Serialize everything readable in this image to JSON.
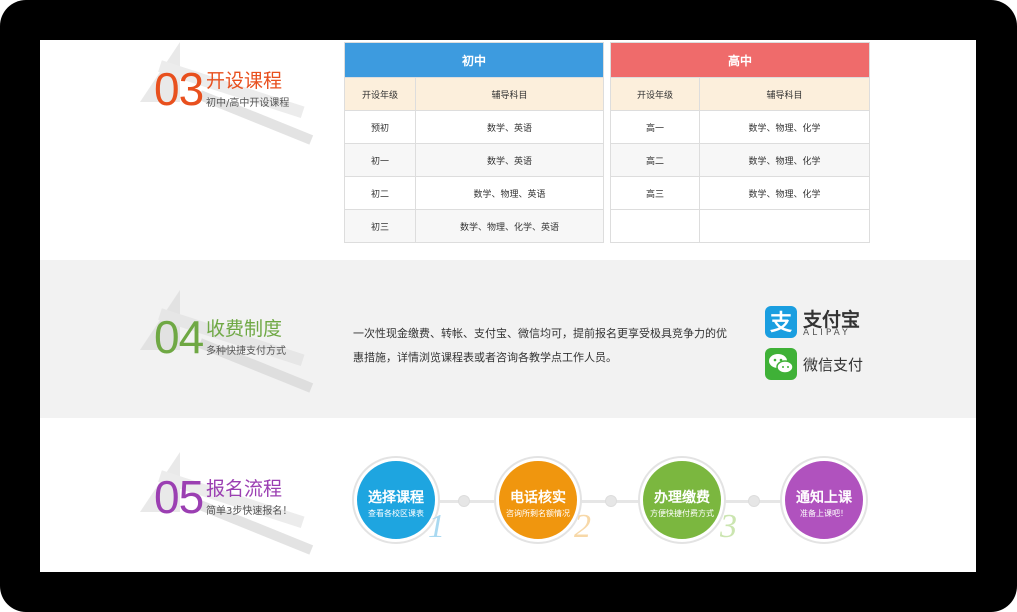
{
  "s03": {
    "num": "03",
    "title": "开设课程",
    "sub": "初中/高中开设课程"
  },
  "s04": {
    "num": "04",
    "title": "收费制度",
    "sub": "多种快捷支付方式"
  },
  "s05": {
    "num": "05",
    "title": "报名流程",
    "sub": "简单3步快速报名！"
  },
  "colors": {
    "orange": "#e8501e",
    "green": "#6fa844",
    "purple": "#9b3fb2",
    "blue_head": "#3d9bdf",
    "red_head": "#ef6b6b"
  },
  "junior": {
    "title": "初中",
    "headers": [
      "开设年级",
      "辅导科目"
    ],
    "rows": [
      [
        "预初",
        "数学、英语"
      ],
      [
        "初一",
        "数学、英语"
      ],
      [
        "初二",
        "数学、物理、英语"
      ],
      [
        "初三",
        "数学、物理、化学、英语"
      ]
    ]
  },
  "senior": {
    "title": "高中",
    "headers": [
      "开设年级",
      "辅导科目"
    ],
    "rows": [
      [
        "高一",
        "数学、物理、化学"
      ],
      [
        "高二",
        "数学、物理、化学"
      ],
      [
        "高三",
        "数学、物理、化学"
      ],
      [
        "",
        ""
      ]
    ]
  },
  "fee": {
    "text": "一次性现金缴费、转帐、支付宝、微信均可，提前报名更享受极具竞争力的优惠措施，详情浏览课程表或者咨询各教学点工作人员。",
    "alipay_cn": "支付宝",
    "alipay_en": "ALIPAY",
    "alipay_icon": "alipay-icon",
    "wechat": "微信支付",
    "wechat_icon": "wechat-icon"
  },
  "steps": [
    {
      "title": "选择课程",
      "sub": "查看各校区课表",
      "num": "1",
      "color": "#1ea5e0"
    },
    {
      "title": "电话核实",
      "sub": "咨询所剩名额情况",
      "num": "2",
      "color": "#f0960e"
    },
    {
      "title": "办理缴费",
      "sub": "方便快捷付费方式",
      "num": "3",
      "color": "#7bb73f"
    },
    {
      "title": "通知上课",
      "sub": "准备上课吧！",
      "num": "",
      "color": "#b052be"
    }
  ]
}
